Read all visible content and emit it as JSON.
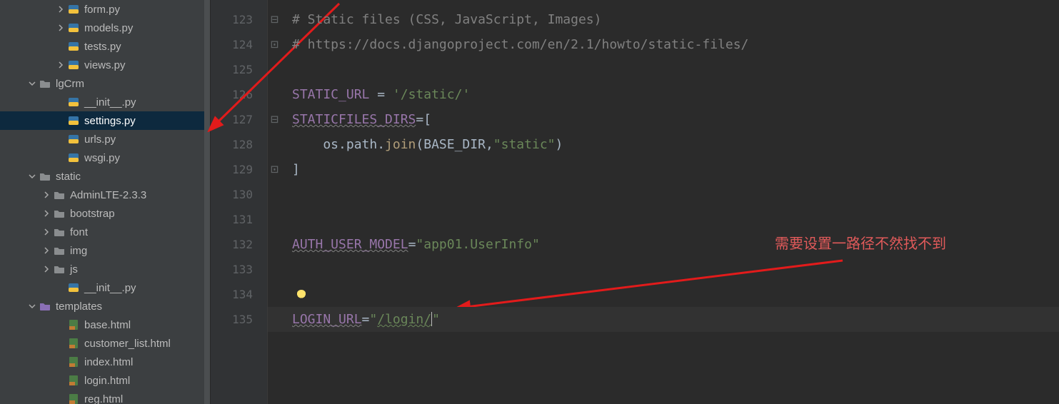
{
  "sidebar": {
    "items": [
      {
        "label": "form.py",
        "type": "py",
        "indent": "ind-file-a",
        "chevron": "right"
      },
      {
        "label": "models.py",
        "type": "py",
        "indent": "ind-file-a",
        "chevron": "right"
      },
      {
        "label": "tests.py",
        "type": "py",
        "indent": "ind-file-a",
        "chevron": null
      },
      {
        "label": "views.py",
        "type": "py",
        "indent": "ind-file-a",
        "chevron": "right"
      },
      {
        "label": "lgCrm",
        "type": "folder",
        "indent": "ind-1",
        "chevron": "down"
      },
      {
        "label": "__init__.py",
        "type": "py",
        "indent": "ind-file-b",
        "chevron": null
      },
      {
        "label": "settings.py",
        "type": "py",
        "indent": "ind-file-b",
        "chevron": null,
        "selected": true
      },
      {
        "label": "urls.py",
        "type": "py",
        "indent": "ind-file-b",
        "chevron": null
      },
      {
        "label": "wsgi.py",
        "type": "py",
        "indent": "ind-file-b",
        "chevron": null
      },
      {
        "label": "static",
        "type": "folder",
        "indent": "ind-1",
        "chevron": "down"
      },
      {
        "label": "AdminLTE-2.3.3",
        "type": "folder",
        "indent": "ind-static-sub",
        "chevron": "right"
      },
      {
        "label": "bootstrap",
        "type": "folder",
        "indent": "ind-static-sub",
        "chevron": "right"
      },
      {
        "label": "font",
        "type": "folder",
        "indent": "ind-static-sub",
        "chevron": "right"
      },
      {
        "label": "img",
        "type": "folder",
        "indent": "ind-static-sub",
        "chevron": "right"
      },
      {
        "label": "js",
        "type": "folder",
        "indent": "ind-static-sub",
        "chevron": "right"
      },
      {
        "label": "__init__.py",
        "type": "py",
        "indent": "ind-file-b",
        "chevron": null
      },
      {
        "label": "templates",
        "type": "folder-purple",
        "indent": "ind-1",
        "chevron": "down"
      },
      {
        "label": "base.html",
        "type": "html",
        "indent": "ind-file-b",
        "chevron": null
      },
      {
        "label": "customer_list.html",
        "type": "html",
        "indent": "ind-file-b",
        "chevron": null
      },
      {
        "label": "index.html",
        "type": "html",
        "indent": "ind-file-b",
        "chevron": null
      },
      {
        "label": "login.html",
        "type": "html",
        "indent": "ind-file-b",
        "chevron": null
      },
      {
        "label": "reg.html",
        "type": "html",
        "indent": "ind-file-b",
        "chevron": null
      }
    ]
  },
  "editor": {
    "first_line_no": 123,
    "last_line_no": 135,
    "lines": {
      "123": [
        {
          "t": "# Static files (CSS, JavaScript, Images)",
          "c": "c-comment"
        }
      ],
      "124": [
        {
          "t": "# https://docs.djangoproject.com/en/2.1/howto/static-files/",
          "c": "c-comment"
        }
      ],
      "125": [],
      "126": [
        {
          "t": "STATIC_URL ",
          "c": "c-ident"
        },
        {
          "t": "= ",
          "c": "c-op"
        },
        {
          "t": "'/static/'",
          "c": "c-str"
        }
      ],
      "127": [
        {
          "t": "STATICFILES_DIRS",
          "c": "c-identwavy"
        },
        {
          "t": "=[",
          "c": "c-op"
        }
      ],
      "128": [
        {
          "t": "    os.path.",
          "c": "c-plain"
        },
        {
          "t": "join",
          "c": "c-call"
        },
        {
          "t": "(BASE_DIR",
          "c": "c-plain"
        },
        {
          "t": ",",
          "c": "c-op"
        },
        {
          "t": "\"static\"",
          "c": "c-str"
        },
        {
          "t": ")",
          "c": "c-plain"
        }
      ],
      "129": [
        {
          "t": "]",
          "c": "c-op"
        }
      ],
      "130": [],
      "131": [],
      "132": [
        {
          "t": "AUTH_USER_MODEL",
          "c": "c-identwavy"
        },
        {
          "t": "=",
          "c": "c-op"
        },
        {
          "t": "\"app01.UserInfo\"",
          "c": "c-str"
        }
      ],
      "133": [],
      "134": [
        {
          "bulb": true
        }
      ],
      "135": [
        {
          "t": "LOGIN_URL",
          "c": "c-identwavy"
        },
        {
          "t": "=",
          "c": "c-op"
        },
        {
          "t": "\"",
          "c": "c-str"
        },
        {
          "t": "/login/",
          "c": "c-strwavy"
        },
        {
          "caret": true
        },
        {
          "t": "\"",
          "c": "c-str"
        }
      ]
    },
    "current_line": 135,
    "fold_open_lines": [
      123,
      127
    ],
    "fold_close_lines": [
      124,
      129
    ]
  },
  "annotations": {
    "text": "需要设置一路径不然找不到"
  }
}
